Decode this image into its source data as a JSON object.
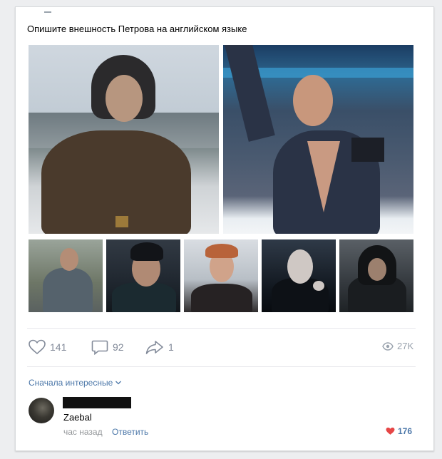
{
  "post": {
    "text": "Опишите внешность Петрова на английском языке"
  },
  "photos": [
    {
      "name": "photo-soldier-ushanka"
    },
    {
      "name": "photo-figure-skater"
    },
    {
      "name": "photo-jacket-group"
    },
    {
      "name": "photo-beanie"
    },
    {
      "name": "photo-redhead"
    },
    {
      "name": "photo-vampire"
    },
    {
      "name": "photo-hoodie"
    }
  ],
  "actions": {
    "likes": "141",
    "comments": "92",
    "shares": "1",
    "views": "27K",
    "icons": [
      "heart-icon",
      "comment-icon",
      "share-icon",
      "eye-icon"
    ]
  },
  "comments_section": {
    "sort_label": "Сначала интересные",
    "comment": {
      "text": "Zaebal",
      "time": "час назад",
      "reply_label": "Ответить",
      "likes": "176"
    }
  },
  "colors": {
    "link": "#4a76a8",
    "muted": "#828a99",
    "heart_active": "#e64646",
    "background": "#edeef0"
  }
}
